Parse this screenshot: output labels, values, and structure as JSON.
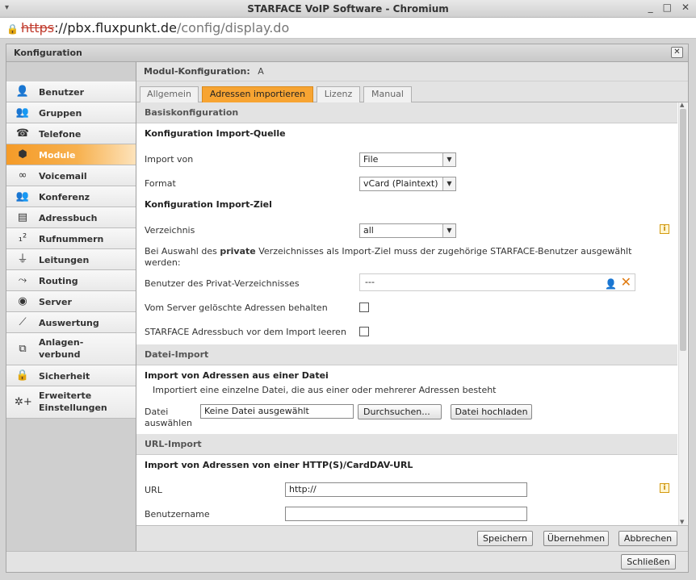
{
  "window": {
    "title": "STARFACE VoIP Software - Chromium",
    "menu_icon": "chevron-down-icon",
    "minimize": "_",
    "maximize": "□",
    "close": "✕"
  },
  "address": {
    "scheme": "https",
    "sep": "://",
    "host": "pbx.fluxpunkt.de",
    "path": "/config/display.do"
  },
  "dialog": {
    "title": "Konfiguration",
    "close": "✕"
  },
  "sidebar": {
    "items": [
      {
        "label": "Benutzer",
        "icon": "user-icon"
      },
      {
        "label": "Gruppen",
        "icon": "group-icon"
      },
      {
        "label": "Telefone",
        "icon": "phone-icon"
      },
      {
        "label": "Module",
        "icon": "module-icon",
        "active": true
      },
      {
        "label": "Voicemail",
        "icon": "voicemail-icon"
      },
      {
        "label": "Konferenz",
        "icon": "conference-icon"
      },
      {
        "label": "Adressbuch",
        "icon": "addressbook-icon"
      },
      {
        "label": "Rufnummern",
        "icon": "numbers-icon"
      },
      {
        "label": "Leitungen",
        "icon": "lines-icon"
      },
      {
        "label": "Routing",
        "icon": "routing-icon"
      },
      {
        "label": "Server",
        "icon": "server-icon"
      },
      {
        "label": "Auswertung",
        "icon": "chart-icon"
      },
      {
        "label": "Anlagen-\nverbund",
        "icon": "network-icon"
      },
      {
        "label": "Sicherheit",
        "icon": "lock-icon"
      },
      {
        "label": "Erweiterte\nEinstellungen",
        "icon": "settings-icon"
      }
    ]
  },
  "main": {
    "modul_label": "Modul-Konfiguration:",
    "modul_value": "A",
    "tabs": [
      {
        "label": "Allgemein"
      },
      {
        "label": "Adressen importieren",
        "active": true
      },
      {
        "label": "Lizenz"
      },
      {
        "label": "Manual"
      }
    ]
  },
  "basis": {
    "section": "Basiskonfiguration",
    "quelle_title": "Konfiguration Import-Quelle",
    "import_von_label": "Import von",
    "import_von_value": "File",
    "format_label": "Format",
    "format_value": "vCard (Plaintext)",
    "ziel_title": "Konfiguration Import-Ziel",
    "verzeichnis_label": "Verzeichnis",
    "verzeichnis_value": "all",
    "note_pre": "Bei Auswahl des ",
    "note_bold": "private",
    "note_post": " Verzeichnisses als Import-Ziel muss der zugehörige STARFACE-Benutzer ausgewählt werden:",
    "benutzer_label": "Benutzer des Privat-Verzeichnisses",
    "benutzer_value": "---",
    "behalten_label": "Vom Server gelöschte Adressen behalten",
    "leeren_label": "STARFACE Adressbuch vor dem Import leeren"
  },
  "datei": {
    "section": "Datei-Import",
    "title": "Import von Adressen aus einer Datei",
    "desc": "Importiert eine einzelne Datei, die aus einer oder mehrerer Adressen besteht",
    "label": "Datei\nauswählen",
    "file_value": "Keine Datei ausgewählt",
    "browse": "Durchsuchen...",
    "upload": "Datei hochladen"
  },
  "url": {
    "section": "URL-Import",
    "title": "Import von Adressen von einer HTTP(S)/CardDAV-URL",
    "url_label": "URL",
    "url_value": "http://",
    "user_label": "Benutzername",
    "user_value": ""
  },
  "footer": {
    "save": "Speichern",
    "apply": "Übernehmen",
    "cancel": "Abbrechen"
  },
  "bottom": {
    "close": "Schließen"
  },
  "colors": {
    "accent": "#f7a432",
    "active_nav": "#f59b28",
    "https_strike": "#c0392b"
  }
}
